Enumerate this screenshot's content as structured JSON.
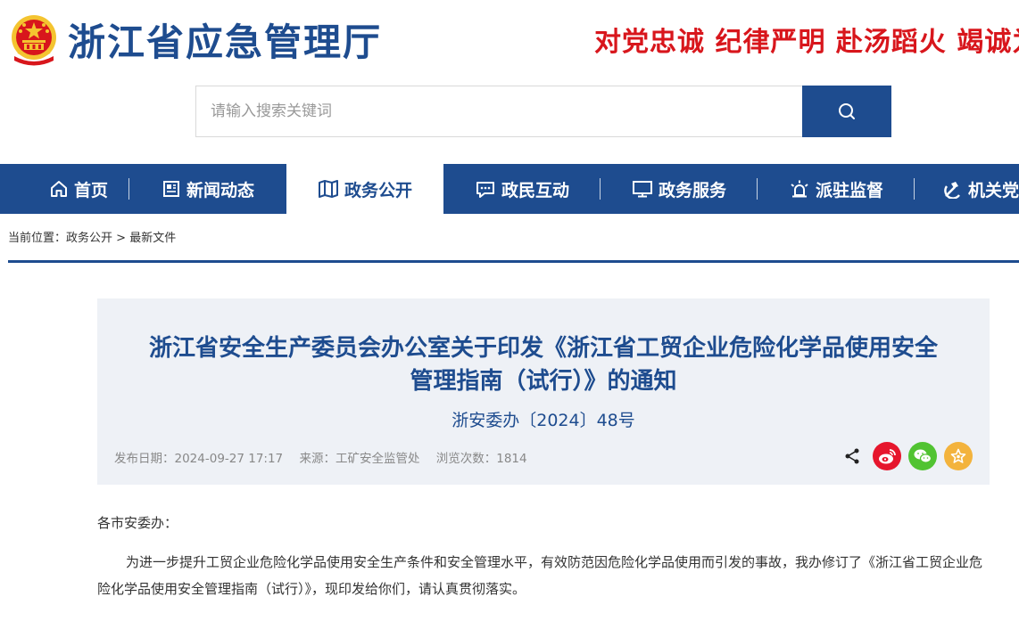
{
  "header": {
    "site_title": "浙江省应急管理厅",
    "slogan": "对党忠诚 纪律严明 赴汤蹈火 竭诚为民"
  },
  "search": {
    "placeholder": "请输入搜索关键词",
    "value": ""
  },
  "nav": {
    "items": [
      {
        "label": "首页",
        "icon": "home-icon"
      },
      {
        "label": "新闻动态",
        "icon": "newspaper-icon"
      },
      {
        "label": "政务公开",
        "icon": "book-icon",
        "active": true
      },
      {
        "label": "政民互动",
        "icon": "chat-icon"
      },
      {
        "label": "政务服务",
        "icon": "monitor-icon"
      },
      {
        "label": "派驻监督",
        "icon": "alarm-light-icon"
      },
      {
        "label": "机关党建",
        "icon": "party-emblem-icon"
      }
    ]
  },
  "breadcrumb": {
    "prefix": "当前位置：",
    "items": [
      "政务公开",
      "最新文件"
    ],
    "separator": ">"
  },
  "article": {
    "title_line1": "浙江省安全生产委员会办公室关于印发《浙江省工贸企业危险化学品使用安全",
    "title_line2": "管理指南（试行）》的通知",
    "doc_number": "浙安委办〔2024〕48号",
    "publish_date": "发布日期：2024-09-27 17:17",
    "source": "来源：工矿安全监管处",
    "views": "浏览次数：1814",
    "share_icons": [
      "share-icon",
      "weibo-icon",
      "wechat-icon",
      "favorite-star-icon"
    ]
  },
  "body": {
    "salutation": "各市安委办：",
    "paragraph1": "为进一步提升工贸企业危险化学品使用安全生产条件和安全管理水平，有效防范因危险化学品使用而引发的事故，我办修订了《浙江省工贸企业危险化学品使用安全管理指南（试行）》，现印发给你们，请认真贯彻落实。"
  },
  "colors": {
    "primary_blue": "#1e4c8f",
    "slogan_red": "#d8161c",
    "header_panel_bg": "#eef1f6",
    "weibo_red": "#e6162d",
    "wechat_green": "#51c332",
    "favorite_gold": "#f3b33d"
  }
}
